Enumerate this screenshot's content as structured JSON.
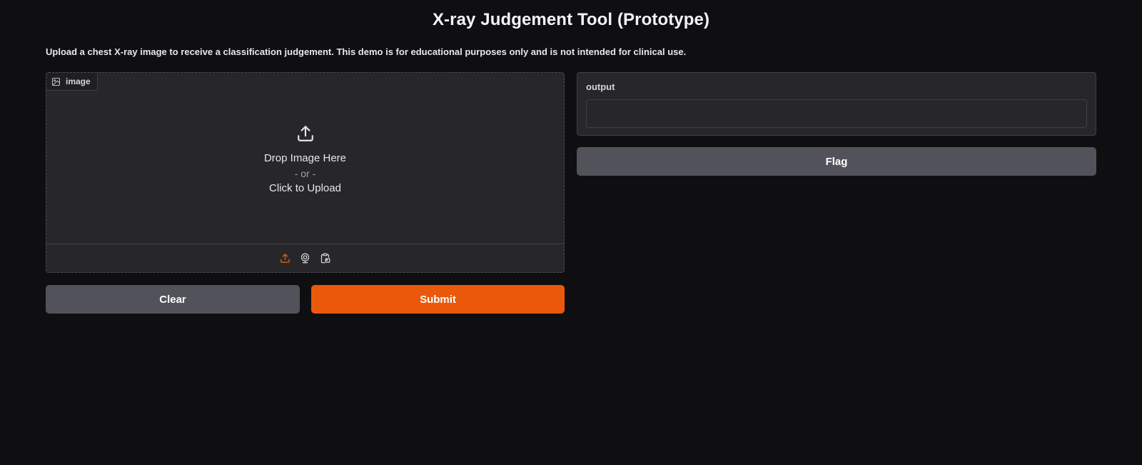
{
  "header": {
    "title": "X-ray Judgement Tool (Prototype)",
    "description": "Upload a chest X-ray image to receive a classification judgement. This demo is for educational purposes only and is not intended for clinical use."
  },
  "image_input": {
    "label": "image",
    "label_icon": "image-icon",
    "upload_icon": "upload-icon",
    "drop_text": "Drop Image Here",
    "or_text": "- or -",
    "click_text": "Click to Upload",
    "sources": [
      {
        "name": "upload",
        "icon": "upload-icon",
        "active": true
      },
      {
        "name": "webcam",
        "icon": "webcam-icon",
        "active": false
      },
      {
        "name": "clipboard",
        "icon": "clipboard-icon",
        "active": false
      }
    ]
  },
  "output": {
    "label": "output",
    "value": ""
  },
  "buttons": {
    "clear": "Clear",
    "submit": "Submit",
    "flag": "Flag"
  },
  "colors": {
    "background": "#0f0f11",
    "panel": "#27272a",
    "accent": "#ea580c",
    "secondary_button": "#52525b"
  }
}
